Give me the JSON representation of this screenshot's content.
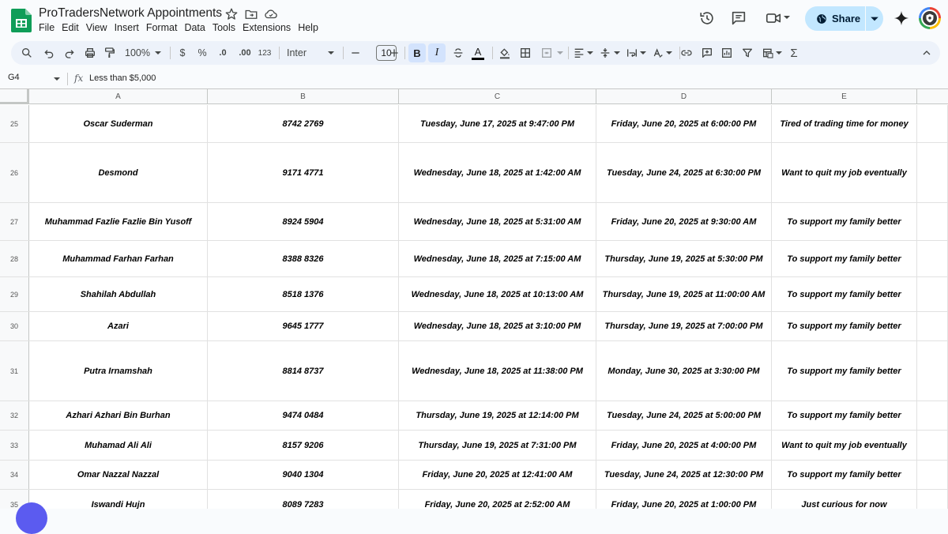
{
  "app": {
    "title": "ProTradersNetwork Appointments",
    "menu": [
      "File",
      "Edit",
      "View",
      "Insert",
      "Format",
      "Data",
      "Tools",
      "Extensions",
      "Help"
    ],
    "share_label": "Share"
  },
  "toolbar": {
    "zoom": "100%",
    "currency": "$",
    "percent": "%",
    "dec_less": ".0",
    "dec_more": ".00",
    "number_format": "123",
    "font": "Inter",
    "font_size": "10",
    "bold": "B",
    "italic": "I",
    "text_color_letter": "A",
    "sigma": "Σ"
  },
  "formula_bar": {
    "cell_ref": "G4",
    "fx": "fx",
    "value": "Less than $5,000"
  },
  "columns": [
    "A",
    "B",
    "C",
    "D",
    "E"
  ],
  "rows": [
    {
      "num": "25",
      "name": "Oscar Suderman",
      "phone": "8742 2769",
      "submitted": "Tuesday, June 17, 2025 at 9:47:00 PM",
      "appointment": "Friday, June 20, 2025 at 6:00:00 PM",
      "reason": "Tired of trading time for money"
    },
    {
      "num": "26",
      "name": "Desmond",
      "phone": "9171 4771",
      "submitted": "Wednesday, June 18, 2025 at 1:42:00 AM",
      "appointment": "Tuesday, June 24, 2025 at 6:30:00 PM",
      "reason": "Want to quit my job eventually"
    },
    {
      "num": "27",
      "name": "Muhammad Fazlie Fazlie Bin Yusoff",
      "phone": "8924 5904",
      "submitted": "Wednesday, June 18, 2025 at 5:31:00 AM",
      "appointment": "Friday, June 20, 2025 at 9:30:00 AM",
      "reason": "To support my family better"
    },
    {
      "num": "28",
      "name": "Muhammad Farhan Farhan",
      "phone": "8388 8326",
      "submitted": "Wednesday, June 18, 2025 at 7:15:00 AM",
      "appointment": "Thursday, June 19, 2025 at 5:30:00 PM",
      "reason": "To support my family better"
    },
    {
      "num": "29",
      "name": "Shahilah Abdullah",
      "phone": "8518 1376",
      "submitted": "Wednesday, June 18, 2025 at 10:13:00 AM",
      "appointment": "Thursday, June 19, 2025 at 11:00:00 AM",
      "reason": "To support my family better"
    },
    {
      "num": "30",
      "name": "Azari",
      "phone": "9645 1777",
      "submitted": "Wednesday, June 18, 2025 at 3:10:00 PM",
      "appointment": "Thursday, June 19, 2025 at 7:00:00 PM",
      "reason": "To support my family better"
    },
    {
      "num": "31",
      "name": "Putra Irnamshah",
      "phone": "8814 8737",
      "submitted": "Wednesday, June 18, 2025 at 11:38:00 PM",
      "appointment": "Monday, June 30, 2025 at 3:30:00 PM",
      "reason": "To support my family better"
    },
    {
      "num": "32",
      "name": "Azhari Azhari Bin Burhan",
      "phone": "9474 0484",
      "submitted": "Thursday, June 19, 2025 at 12:14:00 PM",
      "appointment": "Tuesday, June 24, 2025 at 5:00:00 PM",
      "reason": "To support my family better"
    },
    {
      "num": "33",
      "name": "Muhamad Ali Ali",
      "phone": "8157 9206",
      "submitted": "Thursday, June 19, 2025 at 7:31:00 PM",
      "appointment": "Friday, June 20, 2025 at 4:00:00 PM",
      "reason": "Want to quit my job eventually"
    },
    {
      "num": "34",
      "name": "Omar Nazzal Nazzal",
      "phone": "9040 1304",
      "submitted": "Friday, June 20, 2025 at 12:41:00 AM",
      "appointment": "Tuesday, June 24, 2025 at 12:30:00 PM",
      "reason": "To support my family better"
    },
    {
      "num": "35",
      "name": "Iswandi Hujn",
      "phone": "8089 7283",
      "submitted": "Friday, June 20, 2025 at 2:52:00 AM",
      "appointment": "Friday, June 20, 2025 at 1:00:00 PM",
      "reason": "Just curious for now"
    }
  ]
}
